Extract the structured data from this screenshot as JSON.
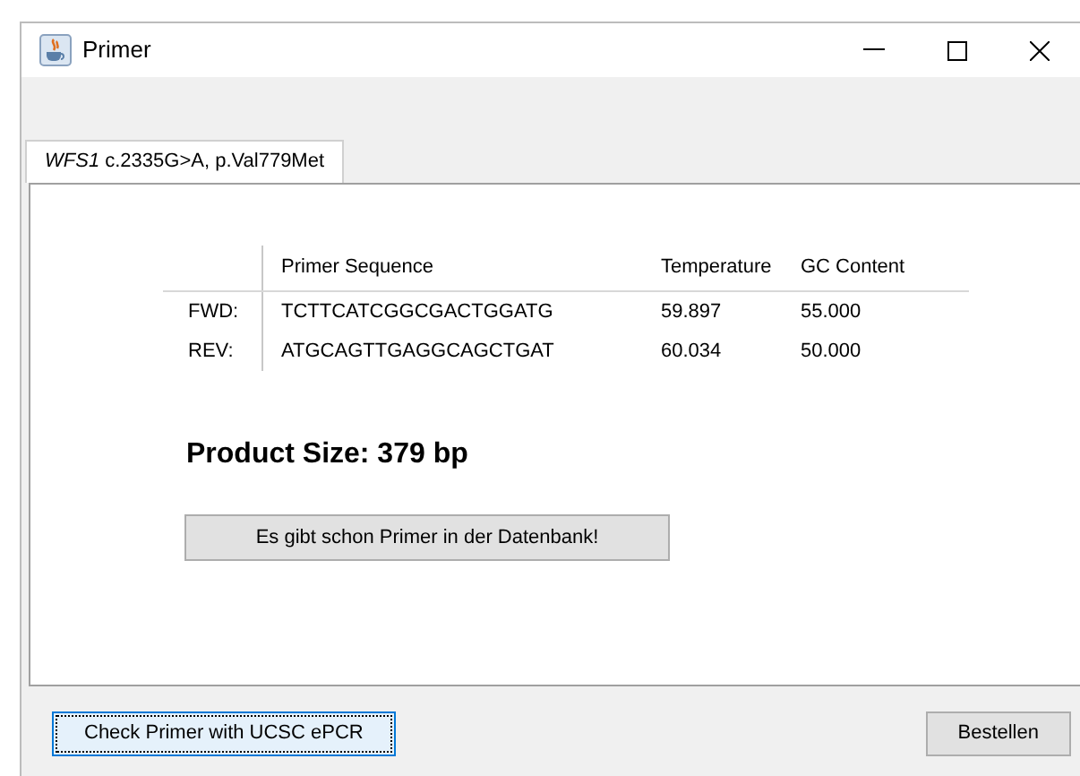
{
  "window": {
    "title": "Primer"
  },
  "tabs": [
    {
      "label": "*WFS1* c.2335G>A, p.Val779Met",
      "selected": true
    }
  ],
  "table": {
    "columns": [
      "Primer Sequence",
      "Temperature",
      "GC Content"
    ],
    "rows": [
      {
        "label": "FWD:",
        "cells": [
          "TCTTCATCGGCGACTGGATG",
          "59.897",
          "55.000"
        ]
      },
      {
        "label": "REV:",
        "cells": [
          "ATGCAGTTGAGGCAGCTGAT",
          "60.034",
          "50.000"
        ]
      }
    ]
  },
  "product_size": "Product Size: 379 bp",
  "database_button": "Es gibt schon Primer in der Datenbank!",
  "buttons": [
    {
      "label": "Check Primer with UCSC ePCR",
      "focused": true
    },
    {
      "label": "Bestellen",
      "focused": false
    }
  ]
}
